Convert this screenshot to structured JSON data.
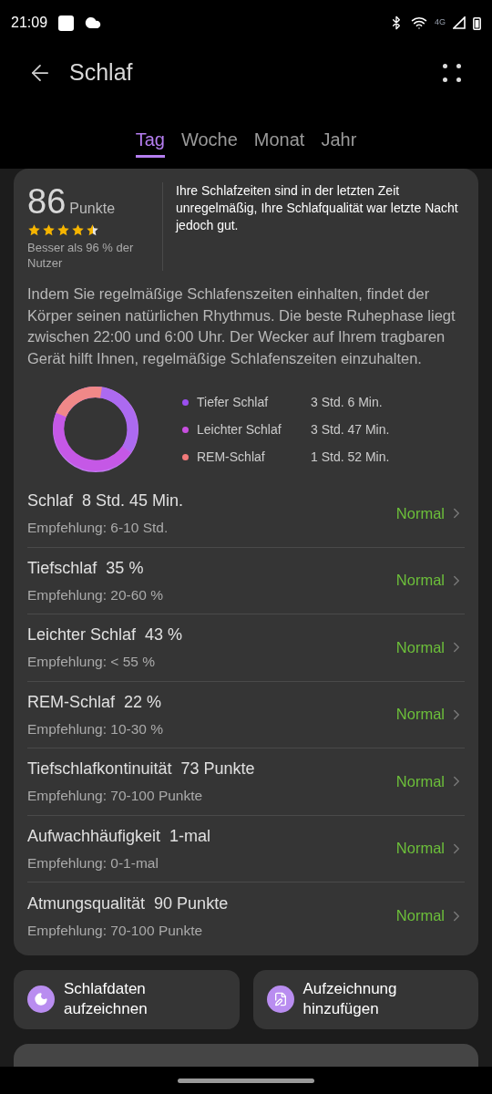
{
  "status_bar": {
    "time": "21:09",
    "network": "4G"
  },
  "header": {
    "title": "Schlaf"
  },
  "tabs": [
    {
      "label": "Tag",
      "selected": true
    },
    {
      "label": "Woche",
      "selected": false
    },
    {
      "label": "Monat",
      "selected": false
    },
    {
      "label": "Jahr",
      "selected": false
    }
  ],
  "score": {
    "value": "86",
    "unit": "Punkte",
    "stars": 4.5,
    "comparison": "Besser als 96 % der Nutzer",
    "summary": "Ihre Schlafzeiten sind in der letzten Zeit unregelmäßig, Ihre Schlafqualität war letzte Nacht jedoch gut."
  },
  "advice": "Indem Sie regelmäßige Schlafenszeiten einhalten, findet der Körper seinen natürlichen Rhythmus. Die beste Ruhephase liegt zwischen 22:00 und 6:00 Uhr. Der Wecker auf Ihrem tragbaren Gerät hilft Ihnen, regelmäßige Schlafenszeiten einzuhalten.",
  "legend": [
    {
      "label": "Tiefer Schlaf",
      "value": "3 Std. 6 Min.",
      "color": "#9b4ff0"
    },
    {
      "label": "Leichter Schlaf",
      "value": "3 Std. 47 Min.",
      "color": "#c84fe0"
    },
    {
      "label": "REM-Schlaf",
      "value": "1 Std. 52 Min.",
      "color": "#f27a7a"
    }
  ],
  "metrics": [
    {
      "name": "Schlaf",
      "value": "8 Std. 45 Min.",
      "recommendation": "Empfehlung: 6-10 Std.",
      "status": "Normal"
    },
    {
      "name": "Tiefschlaf",
      "value": "35 %",
      "recommendation": "Empfehlung: 20-60 %",
      "status": "Normal"
    },
    {
      "name": "Leichter Schlaf",
      "value": "43 %",
      "recommendation": "Empfehlung: < 55 %",
      "status": "Normal"
    },
    {
      "name": "REM-Schlaf",
      "value": "22 %",
      "recommendation": "Empfehlung: 10-30 %",
      "status": "Normal"
    },
    {
      "name": "Tiefschlafkontinuität",
      "value": "73 Punkte",
      "recommendation": "Empfehlung: 70-100 Punkte",
      "status": "Normal"
    },
    {
      "name": "Aufwachhäufigkeit",
      "value": "1-mal",
      "recommendation": "Empfehlung: 0-1-mal",
      "status": "Normal"
    },
    {
      "name": "Atmungsqualität",
      "value": "90 Punkte",
      "recommendation": "Empfehlung: 70-100 Punkte",
      "status": "Normal"
    }
  ],
  "actions": [
    {
      "kind": "sleep",
      "label": "Schlafdaten aufzeichnen"
    },
    {
      "kind": "note",
      "label": "Aufzeichnung hinzufügen"
    }
  ]
}
